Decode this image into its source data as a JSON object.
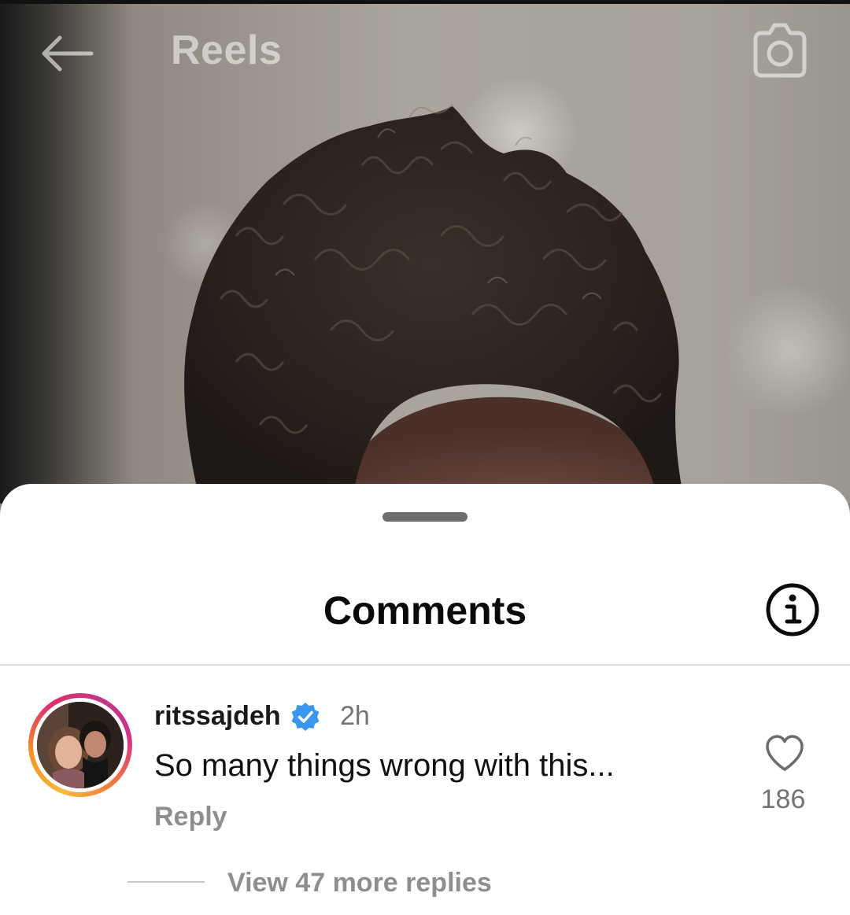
{
  "header": {
    "title": "Reels",
    "back_icon": "back-arrow-icon",
    "camera_icon": "camera-icon"
  },
  "comments_sheet": {
    "title": "Comments",
    "info_icon": "info-icon",
    "comments": [
      {
        "username": "ritssajdeh",
        "verified": true,
        "timestamp": "2h",
        "text": "So many things wrong with this...",
        "reply_label": "Reply",
        "like_icon": "heart-icon",
        "like_count": "186",
        "view_replies_label": "View 47 more replies"
      }
    ]
  },
  "colors": {
    "verified_badge": "#3897f0",
    "secondary_text": "#737373",
    "story_ring": [
      "#f6b93b",
      "#e1306c",
      "#c13584"
    ]
  }
}
